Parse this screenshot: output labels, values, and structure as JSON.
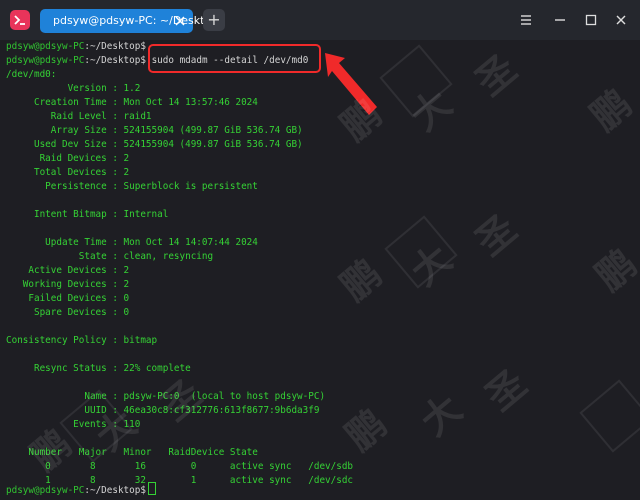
{
  "window": {
    "tab_title": "pdsyw@pdsyw-PC: ~/Desktop",
    "add_tab_label": "+"
  },
  "prompt": {
    "user": "pdsyw@pdsyw-PC",
    "path": ":~/Desktop",
    "symbol": "$"
  },
  "command": "sudo mdadm --detail /dev/md0",
  "output": [
    "/dev/md0:",
    "           Version : 1.2",
    "     Creation Time : Mon Oct 14 13:57:46 2024",
    "        Raid Level : raid1",
    "        Array Size : 524155904 (499.87 GiB 536.74 GB)",
    "     Used Dev Size : 524155904 (499.87 GiB 536.74 GB)",
    "      Raid Devices : 2",
    "     Total Devices : 2",
    "       Persistence : Superblock is persistent",
    "",
    "     Intent Bitmap : Internal",
    "",
    "       Update Time : Mon Oct 14 14:07:44 2024",
    "             State : clean, resyncing",
    "    Active Devices : 2",
    "   Working Devices : 2",
    "    Failed Devices : 0",
    "     Spare Devices : 0",
    "",
    "Consistency Policy : bitmap",
    "",
    "     Resync Status : 22% complete",
    "",
    "              Name : pdsyw-PC:0  (local to host pdsyw-PC)",
    "              UUID : 46ea30c8:cf312776:613f8677:9b6da3f9",
    "            Events : 110",
    "",
    "    Number   Major   Minor   RaidDevice State",
    "       0       8       16        0      active sync   /dev/sdb",
    "       1       8       32        1      active sync   /dev/sdc"
  ],
  "watermark": {
    "chars": [
      "鹏",
      "大",
      "圣"
    ]
  },
  "colors": {
    "prompt_user": "#31c431",
    "prompt_path": "#4aa0f0",
    "output": "#35d235",
    "highlight": "#f02a2a",
    "tab_active": "#1f82d9"
  },
  "icons": [
    "terminal-app-icon",
    "tab-close-icon",
    "add-tab-icon",
    "menu-icon",
    "minimize-icon",
    "maximize-icon",
    "close-icon",
    "red-arrow-icon"
  ]
}
